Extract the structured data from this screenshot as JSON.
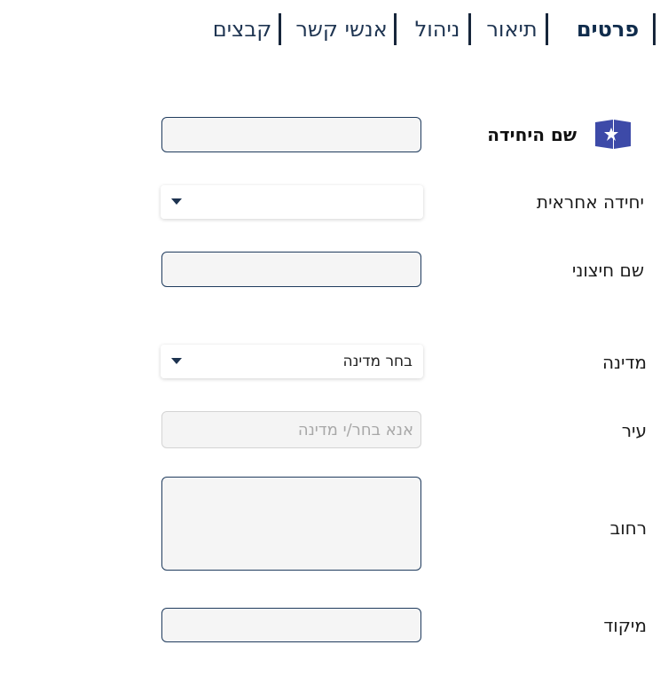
{
  "tabs": [
    {
      "label": "פרטים",
      "active": true
    },
    {
      "label": "תיאור",
      "active": false
    },
    {
      "label": "ניהול",
      "active": false
    },
    {
      "label": "אנשי קשר",
      "active": false
    },
    {
      "label": "קבצים",
      "active": false
    }
  ],
  "header": {
    "unit_name_label": "שם היחידה",
    "logo_icon": "unit-logo-icon",
    "accent_color": "#3d4aa8"
  },
  "fields": {
    "responsible_unit": {
      "label": "יחידה אחראית",
      "value": ""
    },
    "external_name": {
      "label": "שם חיצוני",
      "value": ""
    },
    "country": {
      "label": "מדינה",
      "value": "בחר מדינה"
    },
    "city": {
      "label": "עיר",
      "placeholder": "אנא בחר/י מדינה"
    },
    "street": {
      "label": "רחוב",
      "value": ""
    },
    "zip": {
      "label": "מיקוד",
      "value": ""
    }
  }
}
